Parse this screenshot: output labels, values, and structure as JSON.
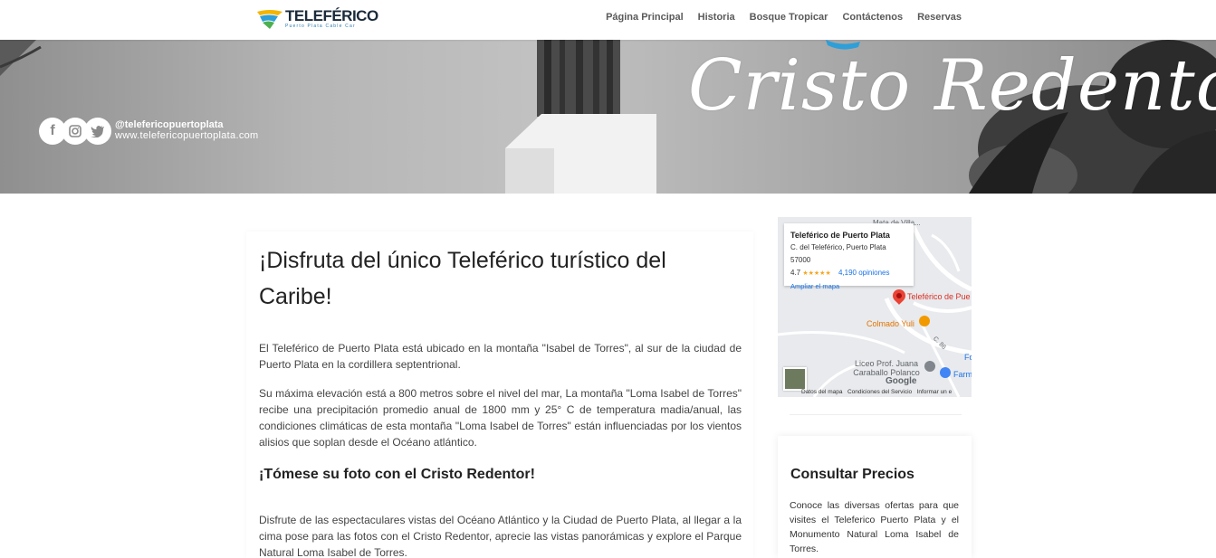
{
  "header": {
    "logo_title": "TELEFÉRICO",
    "logo_subtitle": "Puerto Plata Cable Car",
    "nav": [
      "Página Principal",
      "Historia",
      "Bosque Tropicar",
      "Contáctenos",
      "Reservas"
    ]
  },
  "hero": {
    "script_title": "Cristo Redentor",
    "social_handle": "@telefericopuertoplata",
    "social_url": "www.telefericopuertoplata.com",
    "social_icons": [
      "facebook-icon",
      "instagram-icon",
      "twitter-icon"
    ]
  },
  "main": {
    "title": "¡Disfruta del único Teleférico turístico del Caribe!",
    "paragraph1": "El Teleférico de Puerto Plata está ubicado en la montaña \"Isabel de Torres\", al sur de la ciudad de Puerto Plata en la cordillera septentrional.",
    "paragraph2": "Su máxima elevación está a 800 metros sobre el nivel del mar, La montaña \"Loma Isabel de Torres\" recibe una precipitación promedio anual de 1800 mm y 25° C de temperatura madia/anual, las condiciones climáticas de esta montaña \"Loma Isabel de Torres\" están influenciadas por los vientos alisios que soplan desde el Océano atlántico.",
    "subheading": "¡Tómese su foto con el Cristo Redentor!",
    "paragraph3": "Disfrute de las espectaculares vistas del Océano Atlántico y la Ciudad de Puerto Plata, al llegar a la cima pose para las fotos con el Cristo Redentor, aprecie las vistas panorámicas y explore el Parque Natural Loma Isabel de Torres."
  },
  "map": {
    "place_name": "Teleférico de Puerto Plata",
    "address": "C. del Teleférico, Puerto Plata 57000",
    "rating": "4.7",
    "stars": "★★★★★",
    "reviews": "4,190 opiniones",
    "enlarge_link": "Ampliar el mapa",
    "pin_label": "Teleférico de Pue",
    "poi_colmado": "Colmado Yuli",
    "poi_liceo": "Liceo Prof. Juana Caraballo Polanco",
    "poi_farm": "Farm",
    "poi_top": "Mata de Villa...",
    "road_label": "C. 86",
    "edge_label": "Fo",
    "google": "Google",
    "footer": [
      "Datos del mapa",
      "Condiciones del Servicio",
      "Informar un e"
    ]
  },
  "sidebar": {
    "title": "Consultar Precios",
    "text": "Conoce las diversas ofertas para que visites el Teleferico Puerto Plata y el Monumento Natural Loma Isabel de Torres."
  }
}
